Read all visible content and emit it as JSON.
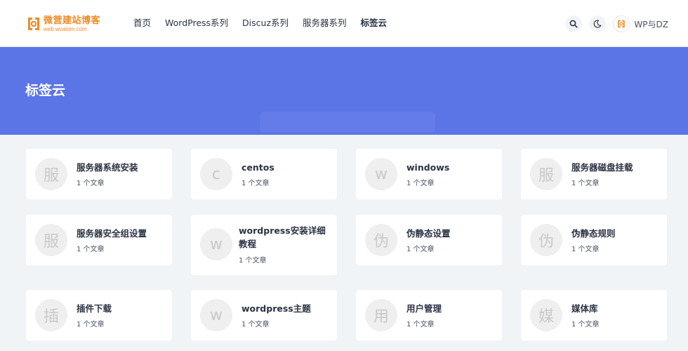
{
  "brand": {
    "title": "微营建站博客",
    "subtitle": "web.woaiom.com",
    "color": "#f08a24"
  },
  "nav": {
    "items": [
      {
        "label": "首页",
        "active": false
      },
      {
        "label": "WordPress系列",
        "active": false
      },
      {
        "label": "Discuz系列",
        "active": false
      },
      {
        "label": "服务器系列",
        "active": false
      },
      {
        "label": "标签云",
        "active": true
      }
    ]
  },
  "toolbar": {
    "search_icon": "search-icon",
    "theme_icon": "moon-icon",
    "user_name": "WP与DZ"
  },
  "banner": {
    "title": "标签云",
    "color": "#5b74e6"
  },
  "tags": [
    {
      "avatar": "服",
      "name": "服务器系统安装",
      "count": "1 个文章"
    },
    {
      "avatar": "c",
      "name": "centos",
      "count": "1 个文章"
    },
    {
      "avatar": "w",
      "name": "windows",
      "count": "1 个文章"
    },
    {
      "avatar": "服",
      "name": "服务器磁盘挂载",
      "count": "1 个文章"
    },
    {
      "avatar": "服",
      "name": "服务器安全组设置",
      "count": "1 个文章"
    },
    {
      "avatar": "w",
      "name": "wordpress安装详细教程",
      "count": "1 个文章"
    },
    {
      "avatar": "伪",
      "name": "伪静态设置",
      "count": "1 个文章"
    },
    {
      "avatar": "伪",
      "name": "伪静态规则",
      "count": "1 个文章"
    },
    {
      "avatar": "插",
      "name": "插件下载",
      "count": "1 个文章"
    },
    {
      "avatar": "w",
      "name": "wordpress主题",
      "count": "1 个文章"
    },
    {
      "avatar": "用",
      "name": "用户管理",
      "count": "1 个文章"
    },
    {
      "avatar": "媒",
      "name": "媒体库",
      "count": "1 个文章"
    }
  ]
}
